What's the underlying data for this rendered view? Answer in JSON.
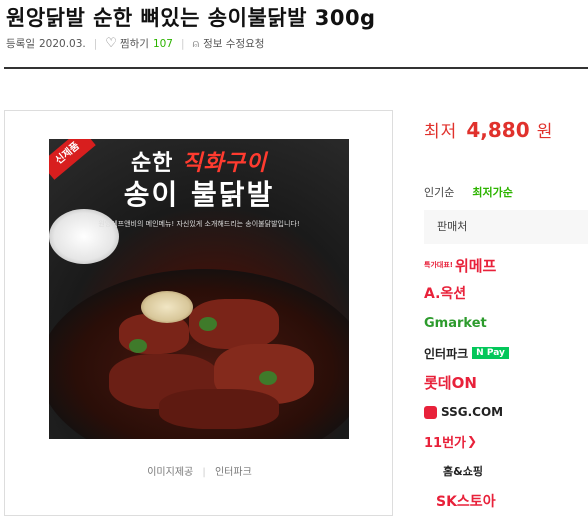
{
  "product": {
    "title": "원앙닭발 순한 뼈있는 송이불닭발 300g",
    "reg_label": "등록일",
    "reg_date": "2020.03.",
    "like_label": "찜하기",
    "like_count": "107",
    "report_label": "정보 수정요청"
  },
  "image": {
    "badge": "신제품",
    "headline_a": "순한",
    "headline_b": "직화구이",
    "headline_2": "송이 불닭발",
    "tagline": "원앙에프앤비의 메인메뉴! 자신있게 소개해드리는 송이불닭발입니다!",
    "caption_label": "이미지제공",
    "caption_source": "인터파크"
  },
  "price": {
    "label": "최저",
    "value": "4,880",
    "unit": "원"
  },
  "sort": {
    "popular": "인기순",
    "lowest": "최저가순"
  },
  "sellers": {
    "header": "판매처",
    "items": [
      {
        "prefix": "특가대표!",
        "name": "위메프",
        "color": "#e8213a"
      },
      {
        "prefix": "",
        "name": "A.옥션",
        "color": "#e8213a"
      },
      {
        "prefix": "",
        "name": "Gmarket",
        "color": "#2d9b2d"
      },
      {
        "prefix": "",
        "name": "인터파크",
        "suffix": "N Pay",
        "color": "#222222"
      },
      {
        "prefix": "",
        "name": "롯데ON",
        "color": "#e8213a"
      },
      {
        "prefix": "",
        "name": "SSG.COM",
        "color": "#222222"
      },
      {
        "prefix": "",
        "name": "11번가",
        "color": "#e8213a"
      },
      {
        "prefix": "",
        "name": "홈&쇼핑",
        "color": "#222222"
      },
      {
        "prefix": "",
        "name": "SK스토아",
        "color": "#e8213a"
      }
    ]
  }
}
